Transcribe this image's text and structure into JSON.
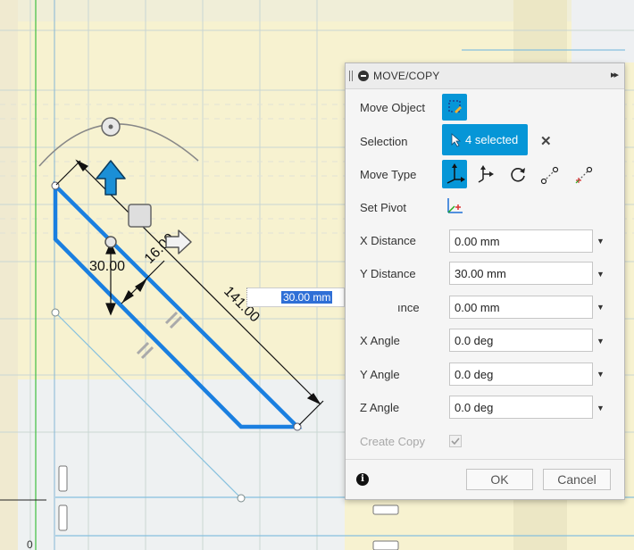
{
  "panel": {
    "title": "MOVE/COPY",
    "expand_glyph": "▸▸",
    "move_object_label": "Move Object",
    "selection_label": "Selection",
    "selection_value": "4 selected",
    "move_type_label": "Move Type",
    "set_pivot_label": "Set Pivot",
    "x_distance_label": "X Distance",
    "x_distance_value": "0.00 mm",
    "y_distance_label": "Y Distance",
    "y_distance_value": "30.00 mm",
    "z_distance_label_partial": "ınce",
    "z_distance_value": "0.00 mm",
    "x_angle_label": "X Angle",
    "x_angle_value": "0.0 deg",
    "y_angle_label": "Y Angle",
    "y_angle_value": "0.0 deg",
    "z_angle_label": "Z Angle",
    "z_angle_value": "0.0 deg",
    "create_copy_label": "Create Copy",
    "create_copy_checked": true,
    "ok_label": "OK",
    "cancel_label": "Cancel",
    "info_glyph": "i",
    "clear_glyph": "✕"
  },
  "viewport": {
    "floating_input_value": "30.00 mm",
    "dim_vertical": "30.00",
    "dim_width": "16.00",
    "dim_length": "141.00",
    "colors": {
      "sketch_blue": "#1a7fe0",
      "background_yellow": "#f5f0c8",
      "selection_blue": "#0696d7",
      "arrow_blue": "#1b8fd6"
    }
  }
}
